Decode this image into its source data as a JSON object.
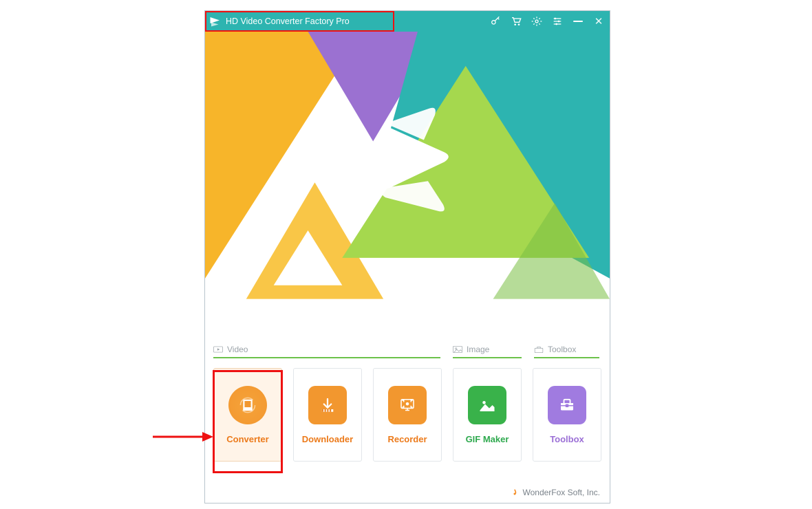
{
  "title": "HD Video Converter Factory Pro",
  "footer": "WonderFox Soft, Inc.",
  "categories": {
    "video": "Video",
    "image": "Image",
    "toolbox": "Toolbox"
  },
  "cards": {
    "converter": {
      "label": "Converter"
    },
    "downloader": {
      "label": "Downloader"
    },
    "recorder": {
      "label": "Recorder"
    },
    "gifmaker": {
      "label": "GIF Maker"
    },
    "toolbox": {
      "label": "Toolbox"
    }
  }
}
